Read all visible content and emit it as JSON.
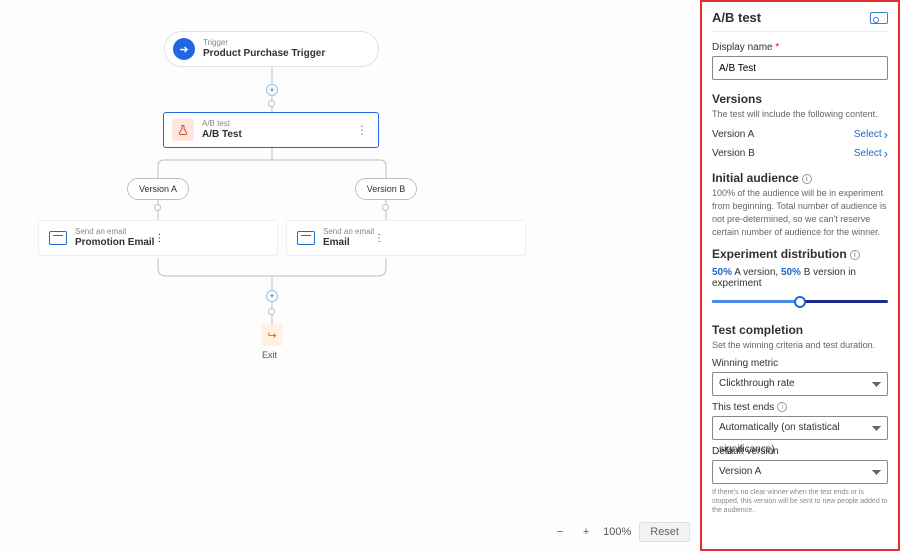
{
  "canvas": {
    "trigger": {
      "kicker": "Trigger",
      "title": "Product Purchase Trigger"
    },
    "ab": {
      "kicker": "A/B test",
      "title": "A/B Test"
    },
    "branchA": {
      "pill": "Version A",
      "kicker": "Send an email",
      "title": "Promotion Email"
    },
    "branchB": {
      "pill": "Version B",
      "kicker": "Send an email",
      "title": "Email"
    },
    "exit": "Exit",
    "zoom": {
      "value": "100%",
      "reset": "Reset"
    }
  },
  "panel": {
    "title": "A/B test",
    "display_name": {
      "label": "Display name",
      "value": "A/B Test"
    },
    "versions": {
      "heading": "Versions",
      "desc": "The test will include the following content.",
      "a": "Version A",
      "b": "Version B",
      "select": "Select"
    },
    "audience": {
      "heading": "Initial audience",
      "desc": "100% of the audience will be in experiment from beginning. Total number of audience is not pre-determined, so we can't reserve certain number of audience for the winner."
    },
    "distribution": {
      "heading": "Experiment distribution",
      "a_pct": "50%",
      "a_txt": " A version, ",
      "b_pct": "50%",
      "b_txt": " B version in experiment"
    },
    "completion": {
      "heading": "Test completion",
      "desc": "Set the winning criteria and test duration.",
      "metric_label": "Winning metric",
      "metric_value": "Clickthrough rate",
      "ends_label": "This test ends",
      "ends_value": "Automatically (on statistical significance)",
      "default_label": "Default version",
      "default_value": "Version A",
      "footnote": "If there's no clear winner when the test ends or is stopped, this version will be sent to new people added to the audience."
    }
  }
}
